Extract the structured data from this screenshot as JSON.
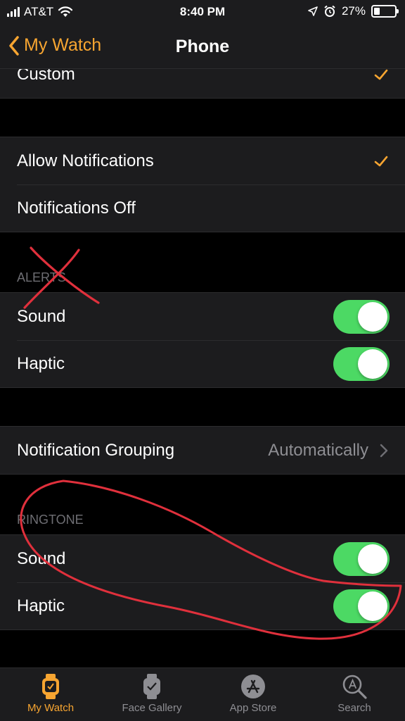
{
  "status": {
    "carrier": "AT&T",
    "time": "8:40 PM",
    "battery": "27%",
    "battery_level": 0.27
  },
  "nav": {
    "back_label": "My Watch",
    "title": "Phone"
  },
  "group1": {
    "custom_label": "Custom"
  },
  "notifications": {
    "allow_label": "Allow Notifications",
    "off_label": "Notifications Off"
  },
  "alerts": {
    "header": "ALERTS",
    "sound_label": "Sound",
    "sound_on": true,
    "haptic_label": "Haptic",
    "haptic_on": true
  },
  "grouping": {
    "label": "Notification Grouping",
    "value": "Automatically"
  },
  "ringtone": {
    "header": "RINGTONE",
    "sound_label": "Sound",
    "sound_on": true,
    "haptic_label": "Haptic",
    "haptic_on": true
  },
  "tabs": [
    {
      "label": "My Watch",
      "icon": "watch-icon",
      "active": true
    },
    {
      "label": "Face Gallery",
      "icon": "face-gallery-icon",
      "active": false
    },
    {
      "label": "App Store",
      "icon": "app-store-icon",
      "active": false
    },
    {
      "label": "Search",
      "icon": "search-icon",
      "active": false
    }
  ],
  "colors": {
    "accent": "#f7a531",
    "toggle_on": "#4cd964",
    "annotation": "#e0303c"
  }
}
